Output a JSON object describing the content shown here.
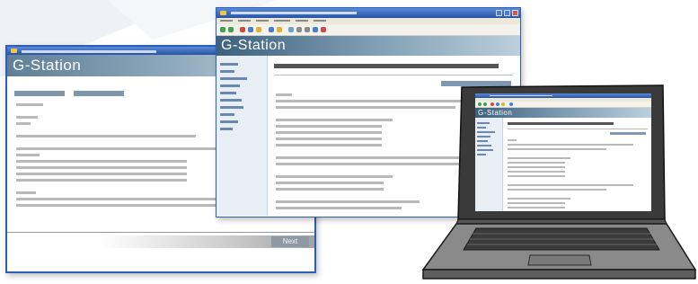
{
  "left_window": {
    "header_title": "G-Station",
    "next_button": "Next"
  },
  "center_window": {
    "header_title": "G-Station"
  },
  "laptop": {
    "screen": {
      "header_title": "G-Station"
    }
  },
  "colors": {
    "window_border": "#2c60b8",
    "title_bar": "#2853a6",
    "header_band": "#5f7f98",
    "sidebar": "#e7eef4",
    "laptop_body": "#8a8a8a",
    "laptop_bezel": "#3a3a3a"
  },
  "icons": [
    "app-icon",
    "window-control-icon",
    "toolbar-icon"
  ]
}
